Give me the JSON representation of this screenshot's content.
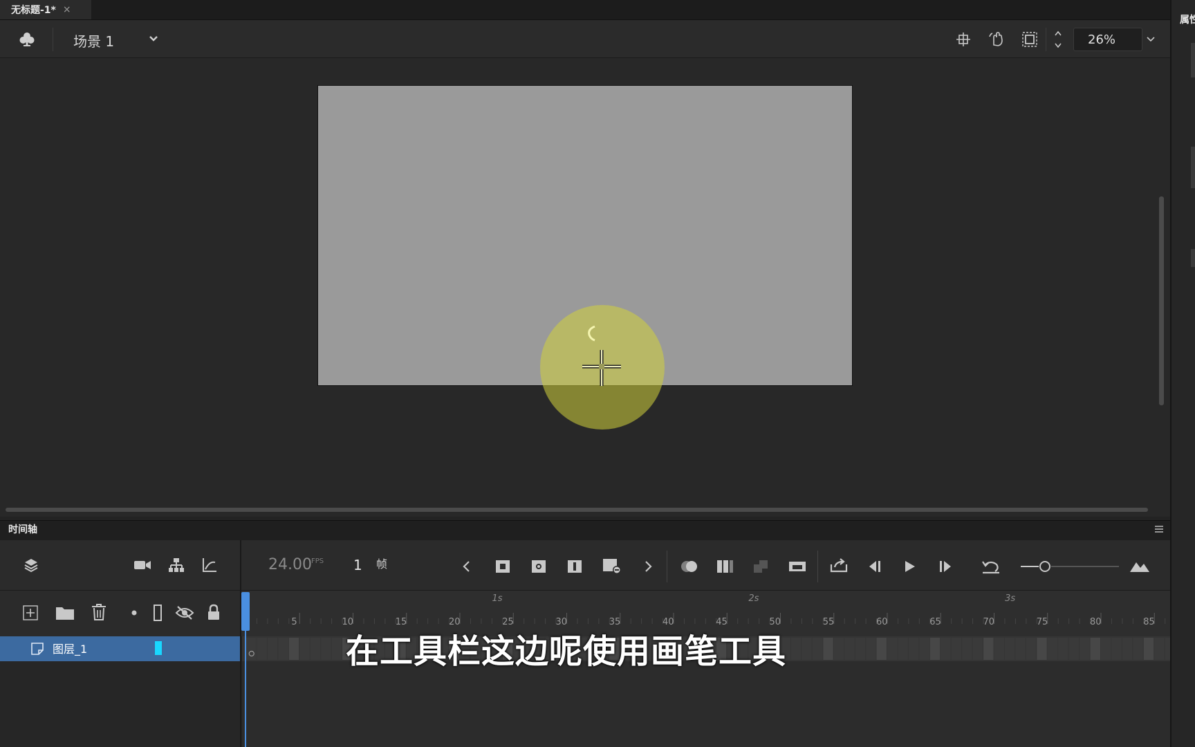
{
  "document_tab": {
    "title": "无标题-1*",
    "close": "×"
  },
  "edit_bar": {
    "scene_name": "场景 1",
    "zoom": "26%"
  },
  "properties_panel": {
    "title": "属性"
  },
  "timeline": {
    "title": "时间轴",
    "fps_value": "24.00",
    "fps_unit": "FPS",
    "current_frame": "1",
    "frame_unit": "帧",
    "ruler_numbers": [
      "5",
      "10",
      "15",
      "20",
      "25",
      "30",
      "35",
      "40",
      "45",
      "50",
      "55",
      "60",
      "65",
      "70",
      "75",
      "80",
      "85"
    ],
    "second_marks": [
      "1s",
      "2s",
      "3s"
    ]
  },
  "layers": [
    {
      "name": "图层_1",
      "color": "#19d7ff"
    }
  ],
  "subtitle": "在工具栏这边呢使用画笔工具",
  "icons": {
    "scene": "club-icon",
    "edit_bar": [
      "center-stage-icon",
      "rotate-hand-icon",
      "clip-stage-icon",
      "zoom-stepper-icon",
      "zoom-dropdown-icon"
    ],
    "timeline_controls": [
      "layers-icon",
      "camera-icon",
      "layer-parenting-icon",
      "graph-icon",
      "prev-keyframe-icon",
      "insert-keyframe-icon",
      "insert-blank-keyframe-icon",
      "insert-frame-icon",
      "remove-frame-icon",
      "next-keyframe-icon",
      "onion-skin-icon",
      "edit-multiple-frames-icon",
      "swap-icon",
      "tween-icon",
      "loop-icon",
      "step-back-icon",
      "play-icon",
      "step-forward-icon",
      "undo-icon",
      "zoom-slider-icon",
      "fit-icon"
    ],
    "layer_tools": [
      "new-layer-icon",
      "new-folder-icon",
      "delete-layer-icon",
      "dot-icon",
      "outline-icon",
      "hide-icon",
      "lock-icon"
    ]
  }
}
